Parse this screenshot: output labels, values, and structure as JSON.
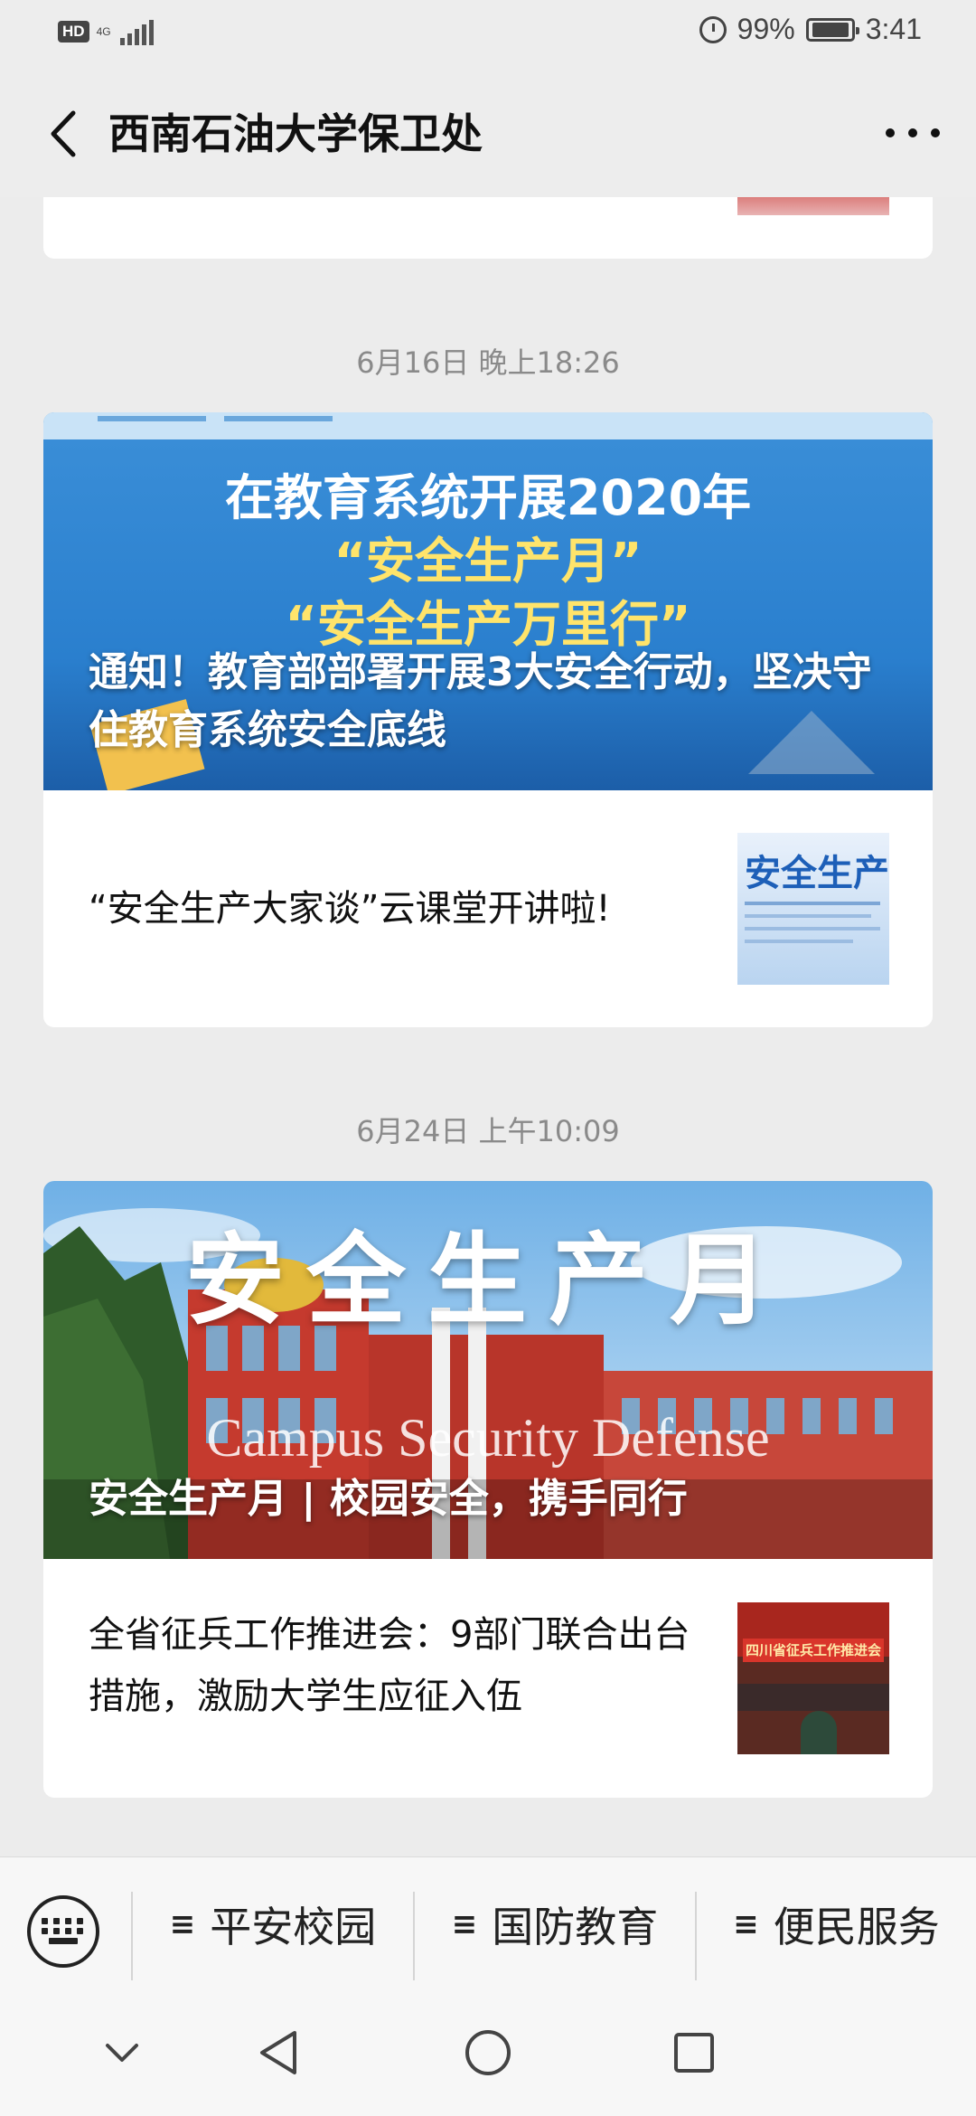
{
  "status_bar": {
    "hd": "HD",
    "network": "4G",
    "alarm_icon": "alarm-icon",
    "battery_percent": "99%",
    "time": "3:41"
  },
  "header": {
    "title": "西南石油大学保卫处",
    "back_icon": "chevron-left-icon",
    "more_icon": "more-icon"
  },
  "feed": [
    {
      "date": "6月16日 晚上18:26",
      "banner_text": [
        "在教育系统开展2020年",
        "“安全生产月”",
        "“安全生产万里行”"
      ],
      "lead_title": "通知！教育部部署开展3大安全行动，坚决守住教育系统安全底线",
      "items": [
        {
          "title": "“安全生产大家谈”云课堂开讲啦!",
          "thumb_text": "安全生产"
        }
      ]
    },
    {
      "date": "6月24日 上午10:09",
      "banner_text": [
        "安全生产月",
        "Campus Security Defense"
      ],
      "lead_title": "安全生产月 | 校园安全，携手同行",
      "items": [
        {
          "title": "全省征兵工作推进会：9部门联合出台措施，激励大学生应征入伍",
          "thumb_text": "四川省征兵工作推进会"
        }
      ]
    }
  ],
  "bottom_menu": {
    "keyboard_icon": "keyboard-icon",
    "items": [
      {
        "label": "平安校园",
        "icon": "menu-icon"
      },
      {
        "label": "国防教育",
        "icon": "menu-icon"
      },
      {
        "label": "便民服务",
        "icon": "menu-icon"
      }
    ]
  },
  "nav_bar": {
    "buttons": [
      "chevron-down-icon",
      "back-triangle-icon",
      "home-circle-icon",
      "recents-square-icon"
    ]
  }
}
